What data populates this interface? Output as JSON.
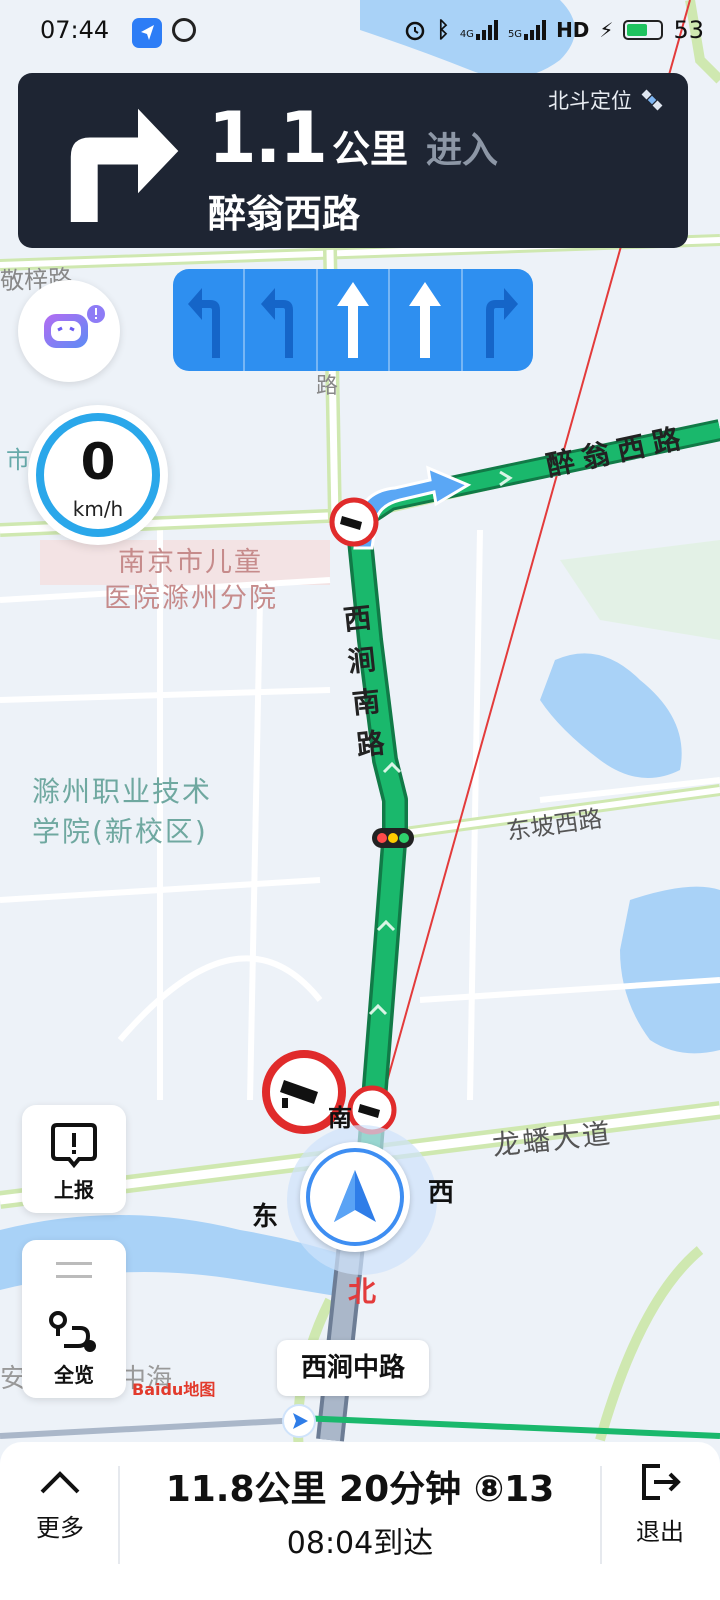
{
  "status_bar": {
    "time": "07:44",
    "network_1": "4G",
    "network_2": "5G",
    "hd": "HD",
    "battery": "53",
    "icons": [
      "navigation-icon",
      "steering-wheel-icon",
      "alarm-icon",
      "bluetooth-icon",
      "signal-icon",
      "charging-icon",
      "battery-icon"
    ]
  },
  "guidance": {
    "turn_direction": "right",
    "distance_value": "1.1",
    "distance_unit": "公里",
    "action": "进入",
    "road": "醉翁西路",
    "positioning": "北斗定位"
  },
  "lanes": [
    "left",
    "left",
    "straight",
    "straight",
    "right"
  ],
  "speed": {
    "value": "0",
    "unit": "km/h"
  },
  "map": {
    "labels": {
      "jingzi": "敬梓路",
      "lu": "路",
      "shi": "市",
      "children_hospital_1": "南京市儿童",
      "children_hospital_2": "医院滁州分院",
      "zuiweng": "醉翁西路",
      "xijian_nan": "西涧南路",
      "college_1": "滁州职业技术",
      "college_2": "学院(新校区)",
      "dongpo": "东坡西路",
      "longfan": "龙蟠大道",
      "compass_south": "南",
      "compass_east": "东",
      "compass_west": "西",
      "compass_north": "北",
      "an": "安",
      "zhonghai": "中海"
    },
    "current_street": "西涧中路",
    "logo": "Baidu地图",
    "colors": {
      "route": "#19b46a",
      "road": "#ffffff",
      "water": "#a8d0f5",
      "hospital_area": "#f3e3e3"
    }
  },
  "side_buttons": {
    "report": "上报",
    "overview": "全览"
  },
  "bottom": {
    "summary": "11.8公里 20分钟 ⑧13",
    "eta": "08:04到达",
    "more": "更多",
    "exit": "退出"
  }
}
